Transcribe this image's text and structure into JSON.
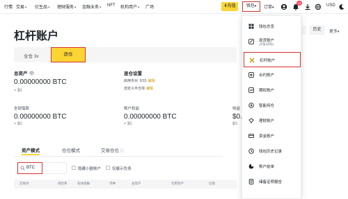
{
  "nav": {
    "items": [
      {
        "label": "行情",
        "chevron": false
      },
      {
        "label": "交易",
        "chevron": true
      },
      {
        "label": "衍生品",
        "chevron": true
      },
      {
        "label": "理财服务",
        "chevron": true
      },
      {
        "label": "金融业务",
        "chevron": true
      },
      {
        "label": "NFT",
        "chevron": false
      },
      {
        "label": "机构用户",
        "chevron": true
      },
      {
        "label": "广场",
        "chevron": false
      }
    ],
    "deposit_label": "充值",
    "wallet_label": "钱包",
    "orders_label": "订单",
    "notification_count": "18",
    "currency": "USD"
  },
  "page": {
    "title": "杠杆账户",
    "history_label": "历史",
    "more_label": "更多"
  },
  "mode_tabs": {
    "cross": "全仓 3x",
    "isolated": "逐仓"
  },
  "stats": {
    "total_assets_label": "总资产",
    "total_assets_value": "0.00000000 BTC",
    "total_assets_fiat": "≈ $0",
    "isolated_settings_label": "逐仓设置",
    "enabled_pairs": "启用币对: 0/15",
    "custom_liquidation": "自定义平仓线",
    "edit_label": "编辑",
    "total_debt_label": "全部借款",
    "total_debt_value": "0.00000000 BTC",
    "total_debt_fiat": "≈ $0",
    "equity_label": "账户权益",
    "equity_value": "0.00000000 BTC",
    "equity_fiat": "≈ $0",
    "pnl_label": "收益",
    "pnl_value": "$0.",
    "pnl_value2": "$0."
  },
  "tabs": {
    "asset_mode": "资产模式",
    "position_mode": "仓位模式",
    "trade_position": "交易仓位"
  },
  "filters": {
    "search_value": "BTC",
    "hide_small": "隐藏小额账户",
    "only_debt": "仅展示负债"
  },
  "table": {
    "headers": [
      "交易对",
      "风险率",
      "有效倍数",
      "币种",
      "总资产",
      "可用资产",
      "已借"
    ]
  },
  "wallet_menu": [
    {
      "label": "钱包总览",
      "sub": "",
      "icon": "grid-icon"
    },
    {
      "label": "现货账户",
      "sub": "(充值&提现)",
      "icon": "spot-icon"
    },
    {
      "label": "杠杆账户",
      "sub": "",
      "icon": "leverage-icon"
    },
    {
      "label": "合约账户",
      "sub": "",
      "icon": "futures-icon"
    },
    {
      "label": "期权账户",
      "sub": "",
      "icon": "options-icon"
    },
    {
      "label": "智能持仓",
      "sub": "",
      "icon": "smart-icon"
    },
    {
      "label": "理财账户",
      "sub": "",
      "icon": "earn-icon"
    },
    {
      "label": "资金账户",
      "sub": "",
      "icon": "funding-icon"
    },
    {
      "label": "钱包历史记录",
      "sub": "",
      "icon": "history-icon"
    },
    {
      "label": "账户结单",
      "sub": "",
      "icon": "statement-icon"
    },
    {
      "label": "储备证明报告",
      "sub": "",
      "icon": "proof-icon"
    }
  ],
  "colors": {
    "brand_yellow": "#fcd535",
    "highlight_red": "#d9302c",
    "text": "#1e2329",
    "muted": "#707a8a",
    "link": "#c99400"
  }
}
